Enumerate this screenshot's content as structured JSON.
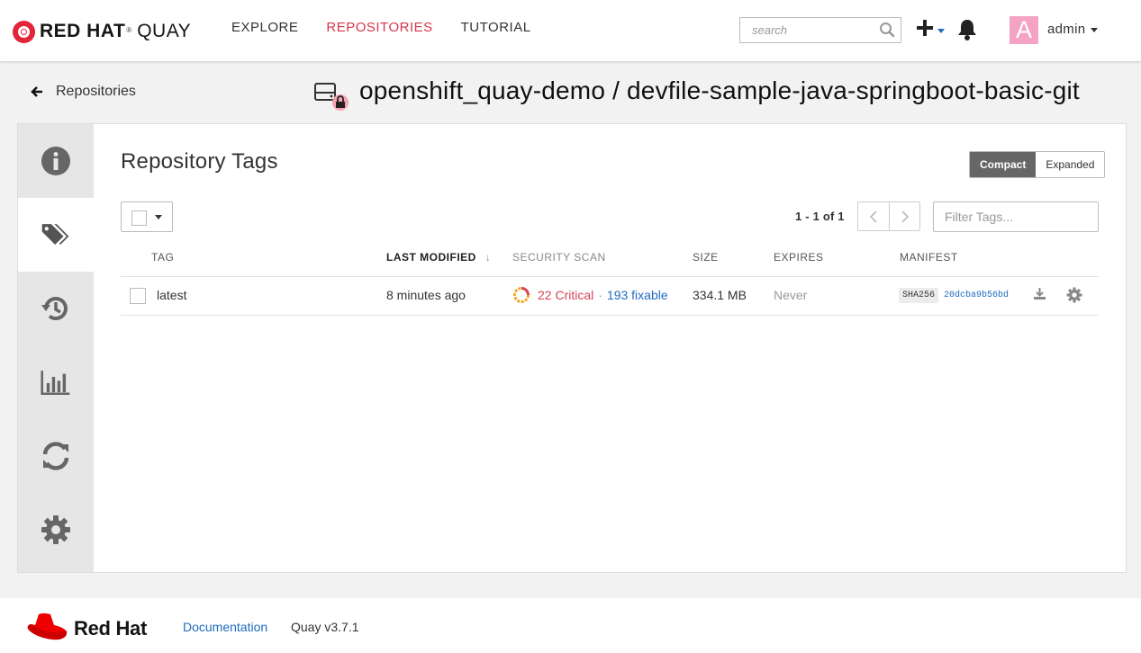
{
  "header": {
    "brand_bold": "RED HAT",
    "brand_light": "QUAY",
    "brand_mark": "®",
    "nav": [
      "EXPLORE",
      "REPOSITORIES",
      "TUTORIAL"
    ],
    "active_nav": "REPOSITORIES",
    "search_placeholder": "search",
    "avatar_letter": "A",
    "username": "admin"
  },
  "breadcrumb": {
    "back_label": "Repositories",
    "repo_title": "openshift_quay-demo / devfile-sample-java-springboot-basic-git"
  },
  "sidebar": {
    "items": [
      "information",
      "tags",
      "history",
      "usage-logs",
      "mirroring",
      "settings"
    ],
    "active": "tags"
  },
  "tags_page": {
    "title": "Repository Tags",
    "view_compact": "Compact",
    "view_expanded": "Expanded",
    "pager_text": "1 - 1 of 1",
    "filter_placeholder": "Filter Tags...",
    "columns": {
      "tag": "TAG",
      "last_modified": "LAST MODIFIED",
      "security_scan": "SECURITY SCAN",
      "size": "SIZE",
      "expires": "EXPIRES",
      "manifest": "MANIFEST"
    },
    "sort_indicator": "↓",
    "rows": [
      {
        "tag": "latest",
        "last_modified": "8 minutes ago",
        "critical": "22 Critical",
        "separator": "·",
        "fixable": "193 fixable",
        "size": "334.1 MB",
        "expires": "Never",
        "sha_label": "SHA256",
        "sha_short": "20dcba9b56bd"
      }
    ]
  },
  "footer": {
    "brand": "Red Hat",
    "documentation": "Documentation",
    "version": "Quay v3.7.1"
  },
  "colors": {
    "accent_red": "#d6374a",
    "link_blue": "#1f6bbf",
    "critical_red": "#d64456",
    "sidebar_bg": "#e6e6e6"
  }
}
